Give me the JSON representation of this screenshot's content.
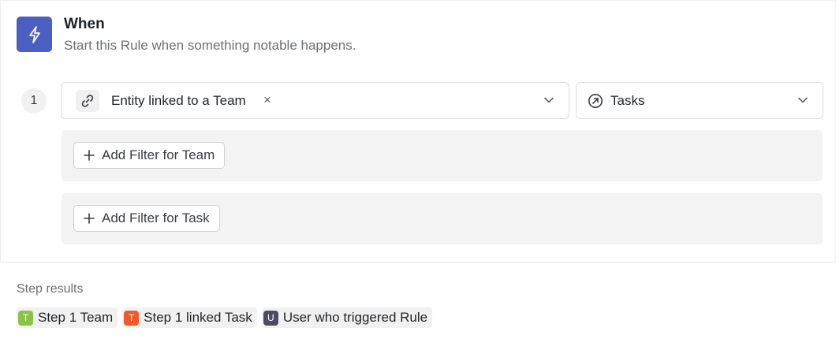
{
  "header": {
    "title": "When",
    "subtitle": "Start this Rule when something notable happens."
  },
  "step": {
    "number": "1",
    "trigger": {
      "label": "Entity linked to a Team",
      "clear_glyph": "×",
      "icon": "link-icon"
    },
    "entity": {
      "label": "Tasks",
      "icon": "arrow-up-right-circle-icon"
    },
    "filters": [
      {
        "label": "Add Filter for Team"
      },
      {
        "label": "Add Filter for Task"
      }
    ]
  },
  "results": {
    "label": "Step results",
    "chips": [
      {
        "letter": "T",
        "label": "Step 1 Team",
        "color": "#8bc34a"
      },
      {
        "letter": "T",
        "label": "Step 1 linked Task",
        "color": "#f0592a"
      },
      {
        "letter": "U",
        "label": "User who triggered Rule",
        "color": "#4b4c63"
      }
    ]
  },
  "colors": {
    "accent": "#4a5fc1"
  }
}
